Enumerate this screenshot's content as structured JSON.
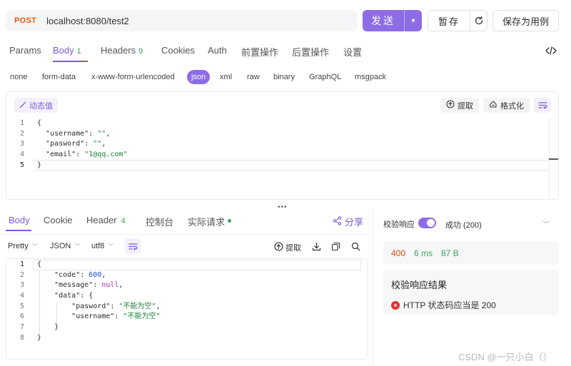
{
  "request": {
    "method": "POST",
    "url": "localhost:8080/test2",
    "send_label": "发送",
    "save_label": "暂存",
    "save_case_label": "保存为用例"
  },
  "request_tabs": [
    {
      "label": "Params"
    },
    {
      "label": "Body",
      "badge": "1"
    },
    {
      "label": "Headers",
      "badge": "9"
    },
    {
      "label": "Cookies"
    },
    {
      "label": "Auth"
    },
    {
      "label": "前置操作"
    },
    {
      "label": "后置操作"
    },
    {
      "label": "设置"
    }
  ],
  "body_types": [
    "none",
    "form-data",
    "x-www-form-urlencoded",
    "json",
    "xml",
    "raw",
    "binary",
    "GraphQL",
    "msgpack"
  ],
  "body_type_selected": "json",
  "editor_toolbar": {
    "dynamic_value": "动态值",
    "extract": "提取",
    "format": "格式化"
  },
  "request_body_lines": [
    "1",
    "2",
    "3",
    "4",
    "5"
  ],
  "request_body": {
    "username_key": "\"username\"",
    "username_val": "\"\"",
    "pasword_key": "\"pasword\"",
    "pasword_val": "\"\"",
    "email_key": "\"email\"",
    "email_val": "\"1@qq.com\""
  },
  "response_tabs": [
    {
      "label": "Body"
    },
    {
      "label": "Cookie"
    },
    {
      "label": "Header",
      "badge": "4"
    },
    {
      "label": "控制台"
    },
    {
      "label": "实际请求"
    }
  ],
  "share_label": "分享",
  "response_toolbar": {
    "view": "Pretty",
    "format": "JSON",
    "encoding": "utf8",
    "extract": "提取"
  },
  "response_body_lines": [
    "1",
    "2",
    "3",
    "4",
    "5",
    "6",
    "7",
    "8"
  ],
  "response_body": {
    "code_key": "\"code\"",
    "code_val": "600",
    "message_key": "\"message\"",
    "message_val": "null",
    "data_key": "\"data\"",
    "pasword_key": "\"pasword\"",
    "pasword_val": "\"不能为空\"",
    "username_key": "\"username\"",
    "username_val": "\"不能为空\""
  },
  "validation": {
    "label": "校验响应",
    "enabled": true,
    "status": "成功 (200)",
    "status_code": "400",
    "time": "6 ms",
    "size": "87 B",
    "result_title": "校验响应结果",
    "result_item": "HTTP 状态码应当是 200"
  },
  "watermark": "CSDN @一只小白（）",
  "colors": {
    "accent": "#8e6ce6",
    "method": "#e8590c",
    "success": "#3fa35b",
    "error": "#e03131",
    "status_code": "#d9480f"
  }
}
